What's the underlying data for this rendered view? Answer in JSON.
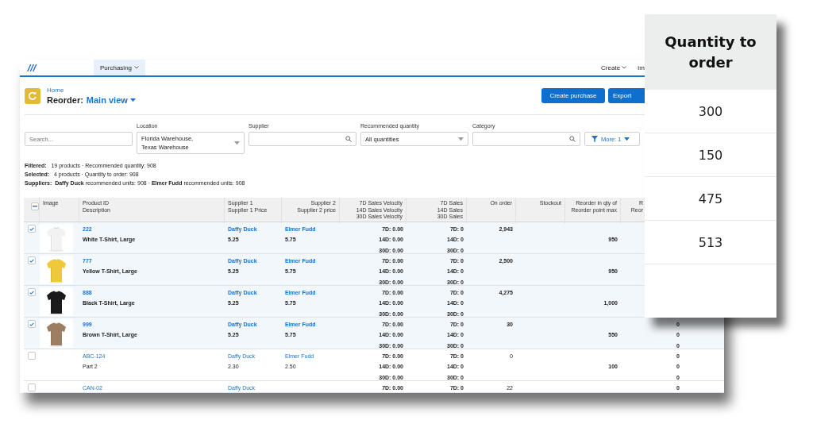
{
  "nav": {
    "tabs": [
      {
        "label": "Purchasing",
        "selected": true
      }
    ],
    "right_items": [
      "Create",
      "Im"
    ]
  },
  "header": {
    "breadcrumb": "Home",
    "title": "Reorder:",
    "view": "Main view",
    "buttons": [
      {
        "label": "Create purchase"
      },
      {
        "label": "Export"
      }
    ]
  },
  "filters": {
    "search": {
      "placeholder": "Search..."
    },
    "fields": [
      {
        "kind": "select",
        "label": "Location",
        "value": "Florida Warehouse,\nTexas Warehouse"
      },
      {
        "kind": "search",
        "label": "Supplier"
      },
      {
        "kind": "select",
        "label": "Recommended quantity",
        "value": "All quantities"
      },
      {
        "kind": "search",
        "label": "Category"
      }
    ],
    "more_button": "More: 1"
  },
  "summary": [
    "**Filtered:**   19 products · Recommended quantity: 908",
    "**Selected:**   4 products · Quantity to order: 908",
    "**Suppliers:**  **Daffy Duck** recommended units: 908 · **Elmer Fudd** recommended units: 908"
  ],
  "table": {
    "select_all": {
      "indeterminate": true
    },
    "columns": [
      {
        "lines": [
          "Image"
        ]
      },
      {
        "lines": [
          "Product ID",
          "Description"
        ]
      },
      {
        "lines": [
          "Supplier 1",
          "Supplier 1 Price"
        ]
      },
      {
        "lines": [
          "Supplier 2",
          "Supplier 2 price"
        ]
      },
      {
        "lines": [
          "7D Sales Velocity",
          "14D Sales Velocity",
          "30D Sales Velocity"
        ]
      },
      {
        "lines": [
          "7D Sales",
          "14D Sales",
          "30D Sales"
        ]
      },
      {
        "lines": [
          "On order"
        ]
      },
      {
        "lines": [
          "Stockout"
        ]
      },
      {
        "lines": [
          "Reorder in qty of",
          "Reorder point max"
        ]
      },
      {
        "lines": [
          "R",
          "Reor"
        ]
      }
    ],
    "rows": [
      {
        "selected": true,
        "image": {
          "kind": "picture",
          "color": "#f2f2f2"
        },
        "id": "222",
        "description": "White T-Shirt, Large",
        "supplier_1": "Daffy Duck",
        "price_1": "5.25",
        "supplier_2": "Elmer Fudd",
        "price_2": "5.75",
        "velocity": [
          "7D: 0.00",
          "14D: 0.00",
          "30D: 0.00"
        ],
        "sales": [
          "7D: 0",
          "14D: 0",
          "30D: 0"
        ],
        "on_order": "2,943",
        "reorder_qty": "950"
      },
      {
        "selected": true,
        "image": {
          "kind": "picture",
          "color": "#f0c93a"
        },
        "id": "777",
        "description": "Yellow T-Shirt, Large",
        "supplier_1": "Daffy Duck",
        "price_1": "5.25",
        "supplier_2": "Elmer Fudd",
        "price_2": "5.75",
        "velocity": [
          "7D: 0.00",
          "14D: 0.00",
          "30D: 0.00"
        ],
        "sales": [
          "7D: 0",
          "14D: 0",
          "30D: 0"
        ],
        "on_order": "2,500",
        "reorder_qty": "950"
      },
      {
        "selected": true,
        "image": {
          "kind": "picture",
          "color": "#1a1a1a"
        },
        "id": "888",
        "description": "Black T-Shirt, Large",
        "supplier_1": "Daffy Duck",
        "price_1": "5.25",
        "supplier_2": "Elmer Fudd",
        "price_2": "5.75",
        "velocity": [
          "7D: 0.00",
          "14D: 0.00",
          "30D: 0.00"
        ],
        "sales": [
          "7D: 0",
          "14D: 0",
          "30D: 0"
        ],
        "on_order": "4,275",
        "reorder_qty": "1,000"
      },
      {
        "selected": true,
        "image": {
          "kind": "picture",
          "color": "#9c7f62"
        },
        "id": "999",
        "description": "Brown T-Shirt, Large",
        "supplier_1": "Daffy Duck",
        "price_1": "5.25",
        "supplier_2": "Elmer Fudd",
        "price_2": "5.75",
        "velocity": [
          "7D: 0.00",
          "14D: 0.00",
          "30D: 0.00"
        ],
        "sales": [
          "7D: 0",
          "14D: 0",
          "30D: 0"
        ],
        "on_order": "30",
        "reorder_qty": "550",
        "column_12": [
          "0",
          "0",
          "0"
        ]
      },
      {
        "selected": false,
        "id": "ABC-124",
        "description": "Part 2",
        "supplier_1": "Daffy Duck",
        "price_1": "2.30",
        "supplier_2": "Elmer Fudd",
        "price_2": "2.50",
        "velocity": [
          "7D: 0.00",
          "14D: 0.00",
          "30D: 0.00"
        ],
        "sales": [
          "7D: 0",
          "14D: 0",
          "30D: 0"
        ],
        "on_order": "0",
        "reorder_qty": "100",
        "column_12": [
          "0",
          "0",
          "0"
        ]
      },
      {
        "selected": false,
        "id": "CAN-02",
        "supplier_1": "Daffy Duck",
        "velocity": [
          "7D: 0.00"
        ],
        "sales": [
          "7D: 0"
        ],
        "on_order": "22",
        "column_12": [
          "0"
        ]
      }
    ]
  },
  "overlay": {
    "title": "Quantity to order",
    "values": [
      "300",
      "150",
      "475",
      "513"
    ]
  }
}
